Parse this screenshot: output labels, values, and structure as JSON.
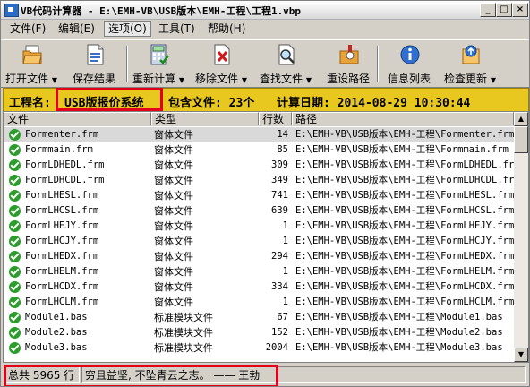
{
  "window": {
    "title": "VB代码计算器 - E:\\EMH-VB\\USB版本\\EMH-工程\\工程1.vbp",
    "controls": [
      "_",
      "□",
      "×"
    ]
  },
  "menu": [
    {
      "label": "文件(F)",
      "active": false
    },
    {
      "label": "编辑(E)",
      "active": false
    },
    {
      "label": "选项(O)",
      "active": true
    },
    {
      "label": "工具(T)",
      "active": false
    },
    {
      "label": "帮助(H)",
      "active": false
    }
  ],
  "toolbar": [
    {
      "label": "打开文件",
      "icon": "folder-open-icon",
      "dropdown": true
    },
    {
      "label": "保存结果",
      "icon": "save-document-icon",
      "dropdown": false
    },
    {
      "label": "重新计算",
      "icon": "recalculate-icon",
      "dropdown": true
    },
    {
      "label": "移除文件",
      "icon": "remove-file-icon",
      "dropdown": true
    },
    {
      "label": "查找文件",
      "icon": "find-file-icon",
      "dropdown": true
    },
    {
      "label": "重设路径",
      "icon": "reset-path-icon",
      "dropdown": false
    },
    {
      "label": "信息列表",
      "icon": "info-list-icon",
      "dropdown": false
    },
    {
      "label": "检查更新",
      "icon": "check-update-icon",
      "dropdown": true
    }
  ],
  "info": {
    "project_label": "工程名:",
    "project_name": "USB版报价系统",
    "files_text": "包含文件: 23个",
    "date_text": "计算日期: 2014-08-29 10:30:44"
  },
  "list": {
    "columns": [
      "文件",
      "类型",
      "行数",
      "路径"
    ],
    "rows": [
      {
        "file": "Formenter.frm",
        "type": "窗体文件",
        "lines": "14",
        "path": "E:\\EMH-VB\\USB版本\\EMH-工程\\Formenter.frm",
        "selected": true
      },
      {
        "file": "Formmain.frm",
        "type": "窗体文件",
        "lines": "85",
        "path": "E:\\EMH-VB\\USB版本\\EMH-工程\\Formmain.frm",
        "selected": false
      },
      {
        "file": "FormLDHEDL.frm",
        "type": "窗体文件",
        "lines": "309",
        "path": "E:\\EMH-VB\\USB版本\\EMH-工程\\FormLDHEDL.frm",
        "selected": false
      },
      {
        "file": "FormLDHCDL.frm",
        "type": "窗体文件",
        "lines": "349",
        "path": "E:\\EMH-VB\\USB版本\\EMH-工程\\FormLDHCDL.frm",
        "selected": false
      },
      {
        "file": "FormLHESL.frm",
        "type": "窗体文件",
        "lines": "741",
        "path": "E:\\EMH-VB\\USB版本\\EMH-工程\\FormLHESL.frm",
        "selected": false
      },
      {
        "file": "FormLHCSL.frm",
        "type": "窗体文件",
        "lines": "639",
        "path": "E:\\EMH-VB\\USB版本\\EMH-工程\\FormLHCSL.frm",
        "selected": false
      },
      {
        "file": "FormLHEJY.frm",
        "type": "窗体文件",
        "lines": "1",
        "path": "E:\\EMH-VB\\USB版本\\EMH-工程\\FormLHEJY.frm",
        "selected": false
      },
      {
        "file": "FormLHCJY.frm",
        "type": "窗体文件",
        "lines": "1",
        "path": "E:\\EMH-VB\\USB版本\\EMH-工程\\FormLHCJY.frm",
        "selected": false
      },
      {
        "file": "FormLHEDX.frm",
        "type": "窗体文件",
        "lines": "294",
        "path": "E:\\EMH-VB\\USB版本\\EMH-工程\\FormLHEDX.frm",
        "selected": false
      },
      {
        "file": "FormLHELM.frm",
        "type": "窗体文件",
        "lines": "1",
        "path": "E:\\EMH-VB\\USB版本\\EMH-工程\\FormLHELM.frm",
        "selected": false
      },
      {
        "file": "FormLHCDX.frm",
        "type": "窗体文件",
        "lines": "334",
        "path": "E:\\EMH-VB\\USB版本\\EMH-工程\\FormLHCDX.frm",
        "selected": false
      },
      {
        "file": "FormLHCLM.frm",
        "type": "窗体文件",
        "lines": "1",
        "path": "E:\\EMH-VB\\USB版本\\EMH-工程\\FormLHCLM.frm",
        "selected": false
      },
      {
        "file": "Module1.bas",
        "type": "标准模块文件",
        "lines": "67",
        "path": "E:\\EMH-VB\\USB版本\\EMH-工程\\Module1.bas",
        "selected": false
      },
      {
        "file": "Module2.bas",
        "type": "标准模块文件",
        "lines": "152",
        "path": "E:\\EMH-VB\\USB版本\\EMH-工程\\Module2.bas",
        "selected": false
      },
      {
        "file": "Module3.bas",
        "type": "标准模块文件",
        "lines": "2004",
        "path": "E:\\EMH-VB\\USB版本\\EMH-工程\\Module3.bas",
        "selected": false
      }
    ]
  },
  "status": {
    "total": "总共 5965 行",
    "quote": "穷且益坚, 不坠青云之志。 —— 王勃"
  },
  "colors": {
    "info_bar": "#e8c71e",
    "highlight_box": "#e4001b",
    "check_green": "#2a9d2a"
  }
}
